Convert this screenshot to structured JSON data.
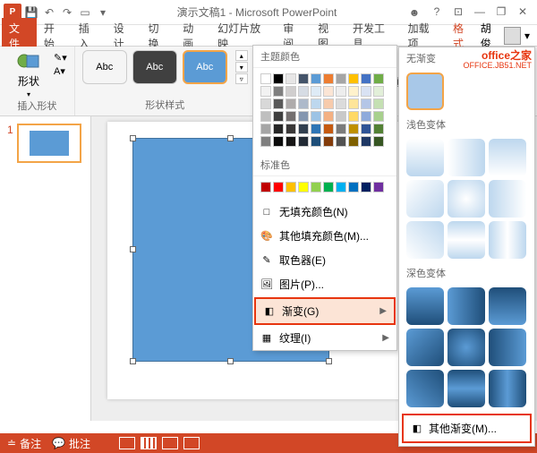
{
  "titlebar": {
    "title": "演示文稿1 - Microsoft PowerPoint"
  },
  "tabs": {
    "file": "文件",
    "home": "开始",
    "insert": "插入",
    "design": "设计",
    "transition": "切换",
    "animation": "动画",
    "slideshow": "幻灯片放映",
    "review": "审阅",
    "view": "视图",
    "developer": "开发工具",
    "addins": "加载项",
    "format": "格式"
  },
  "user": {
    "name": "胡俊"
  },
  "ribbon": {
    "shape_label": "形状",
    "insert_group": "插入形状",
    "style_abc": "Abc",
    "style_group": "形状样式"
  },
  "fill_menu": {
    "theme_colors": "主题颜色",
    "standard_colors": "标准色",
    "no_fill": "无填充颜色(N)",
    "more_colors": "其他填充颜色(M)...",
    "eyedropper": "取色器(E)",
    "picture": "图片(P)...",
    "gradient": "渐变(G)",
    "texture": "纹理(I)"
  },
  "gradient_panel": {
    "no_gradient": "无渐变",
    "light": "浅色变体",
    "dark": "深色变体",
    "more": "其他渐变(M)..."
  },
  "statusbar": {
    "notes": "备注",
    "comments": "批注"
  },
  "watermark": {
    "main": "office之家",
    "sub": "OFFICE.JB51.NET"
  },
  "slide": {
    "number": "1"
  },
  "theme_palette": [
    [
      "#ffffff",
      "#000000",
      "#e7e6e6",
      "#44546a",
      "#5b9bd5",
      "#ed7d31",
      "#a5a5a5",
      "#ffc000",
      "#4472c4",
      "#70ad47"
    ],
    [
      "#f2f2f2",
      "#7f7f7f",
      "#d0cece",
      "#d6dce4",
      "#deebf6",
      "#fbe5d5",
      "#ededed",
      "#fff2cc",
      "#d9e2f3",
      "#e2efd9"
    ],
    [
      "#d8d8d8",
      "#595959",
      "#aeabab",
      "#adb9ca",
      "#bdd7ee",
      "#f7cbac",
      "#dbdbdb",
      "#fee599",
      "#b4c6e7",
      "#c5e0b3"
    ],
    [
      "#bfbfbf",
      "#3f3f3f",
      "#757070",
      "#8496b0",
      "#9cc3e5",
      "#f4b183",
      "#c9c9c9",
      "#ffd965",
      "#8eaadb",
      "#a8d08d"
    ],
    [
      "#a5a5a5",
      "#262626",
      "#3a3838",
      "#323f4f",
      "#2e75b5",
      "#c55a11",
      "#7b7b7b",
      "#bf9000",
      "#2f5496",
      "#538135"
    ],
    [
      "#7f7f7f",
      "#0c0c0c",
      "#171616",
      "#222a35",
      "#1e4e79",
      "#833c0b",
      "#525252",
      "#7f6000",
      "#1f3864",
      "#375623"
    ]
  ],
  "standard_palette": [
    "#c00000",
    "#ff0000",
    "#ffc000",
    "#ffff00",
    "#92d050",
    "#00b050",
    "#00b0f0",
    "#0070c0",
    "#002060",
    "#7030a0"
  ],
  "light_gradients": [
    "linear-gradient(180deg,#fff,#bdd7ee)",
    "linear-gradient(90deg,#fff,#bdd7ee)",
    "linear-gradient(0deg,#fff,#bdd7ee)",
    "linear-gradient(135deg,#fff,#bdd7ee)",
    "radial-gradient(#fff,#bdd7ee)",
    "linear-gradient(270deg,#fff,#bdd7ee)",
    "linear-gradient(45deg,#fff,#bdd7ee)",
    "linear-gradient(180deg,#bdd7ee,#fff,#bdd7ee)",
    "linear-gradient(90deg,#bdd7ee,#fff,#bdd7ee)"
  ],
  "dark_gradients": [
    "linear-gradient(180deg,#5b9bd5,#1f4e79)",
    "linear-gradient(90deg,#5b9bd5,#1f4e79)",
    "linear-gradient(0deg,#5b9bd5,#1f4e79)",
    "linear-gradient(135deg,#5b9bd5,#1f4e79)",
    "radial-gradient(#5b9bd5,#1f4e79)",
    "linear-gradient(270deg,#5b9bd5,#1f4e79)",
    "linear-gradient(45deg,#5b9bd5,#1f4e79)",
    "linear-gradient(180deg,#1f4e79,#5b9bd5,#1f4e79)",
    "linear-gradient(90deg,#1f4e79,#5b9bd5,#1f4e79)"
  ]
}
